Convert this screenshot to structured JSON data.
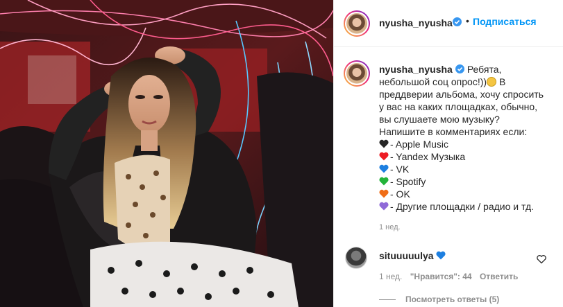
{
  "post": {
    "author": "nyusha_nyusha",
    "follow_label": "Подписаться",
    "dot": "•",
    "caption_lines": [
      "Ребята,",
      "небольшой соц опрос!))",
      "В",
      "преддверии альбома, хочу спросить",
      "у вас на каких площадках, обычно,",
      "вы слушаете мою музыку?",
      "Напишите в комментариях если:"
    ],
    "options": [
      {
        "heart_color": "#262626",
        "label": "- Apple Music"
      },
      {
        "heart_color": "#ed1c24",
        "label": "- Yandex Музыка"
      },
      {
        "heart_color": "#1d7fe0",
        "label": "- VK"
      },
      {
        "heart_color": "#23b33a",
        "label": "- Spotify"
      },
      {
        "heart_color": "#f06d16",
        "label": "- OK"
      },
      {
        "heart_color": "#8f6ad8",
        "label": "- Другие площадки / радио и тд."
      }
    ],
    "time": "1 нед."
  },
  "comment": {
    "author": "situuuuulya",
    "heart_color": "#1d7fe0",
    "time": "1 нед.",
    "likes_label": "\"Нравится\": 44",
    "reply_label": "Ответить",
    "view_replies_label": "Посмотреть ответы (5)"
  },
  "icons": {
    "verified": "verified-badge-icon",
    "like": "heart-outline-icon",
    "emoji": "grinning-face-emoji"
  },
  "colors": {
    "link": "#0095f6",
    "muted": "#8e8e8e",
    "verified": "#3897f0"
  }
}
